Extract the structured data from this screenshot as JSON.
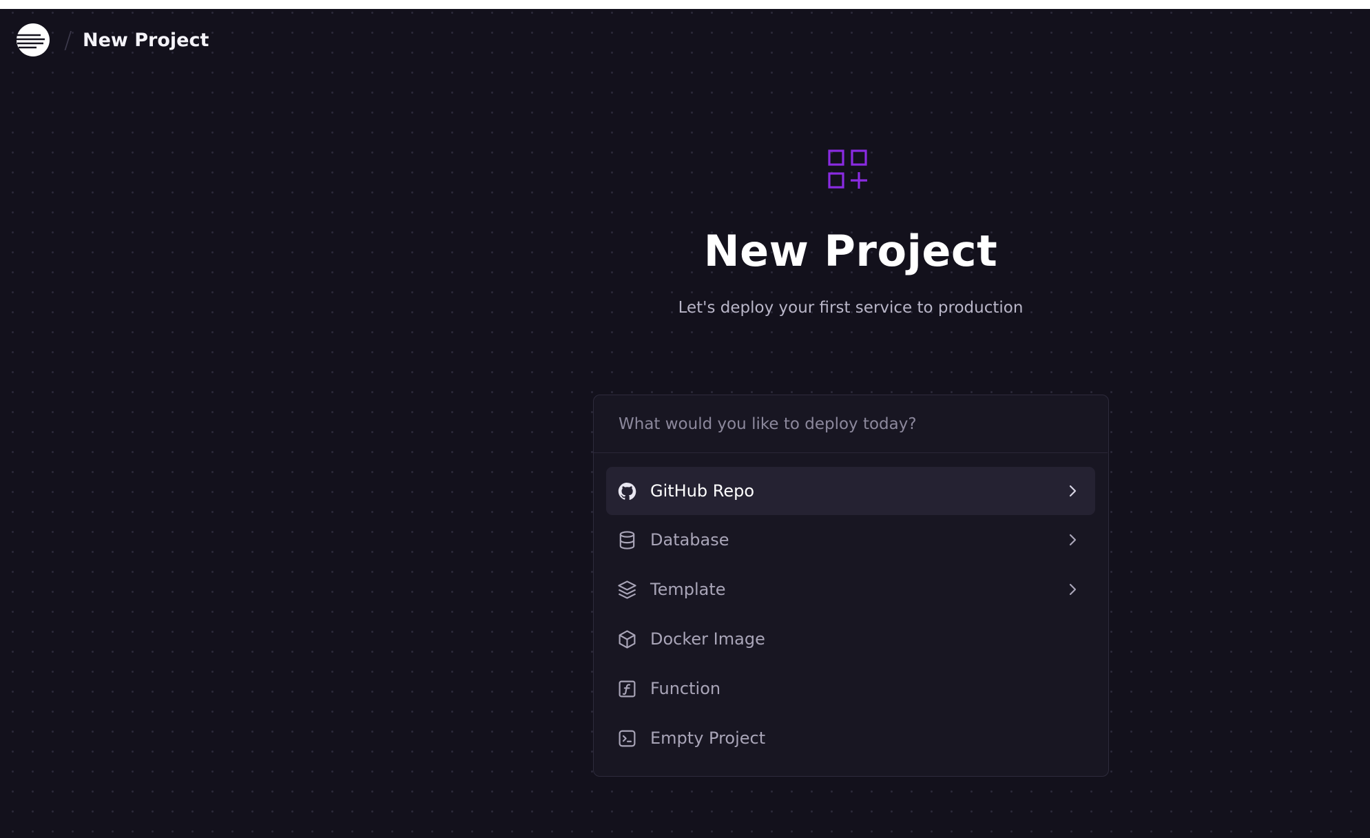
{
  "header": {
    "separator": "/",
    "breadcrumb_title": "New Project"
  },
  "hero": {
    "title": "New Project",
    "subtitle": "Let's deploy your first service to production"
  },
  "deploy_panel": {
    "search_placeholder": "What would you like to deploy today?",
    "options": [
      {
        "label": "GitHub Repo",
        "icon": "github-icon",
        "has_submenu": true,
        "highlighted": true
      },
      {
        "label": "Database",
        "icon": "database-icon",
        "has_submenu": true,
        "highlighted": false
      },
      {
        "label": "Template",
        "icon": "layers-icon",
        "has_submenu": true,
        "highlighted": false
      },
      {
        "label": "Docker Image",
        "icon": "box-icon",
        "has_submenu": false,
        "highlighted": false
      },
      {
        "label": "Function",
        "icon": "function-icon",
        "has_submenu": false,
        "highlighted": false
      },
      {
        "label": "Empty Project",
        "icon": "terminal-icon",
        "has_submenu": false,
        "highlighted": false
      }
    ]
  },
  "colors": {
    "background": "#13111c",
    "panel": "#181622",
    "accent_purple": "#8a2be2",
    "highlight_row": "#252232"
  }
}
